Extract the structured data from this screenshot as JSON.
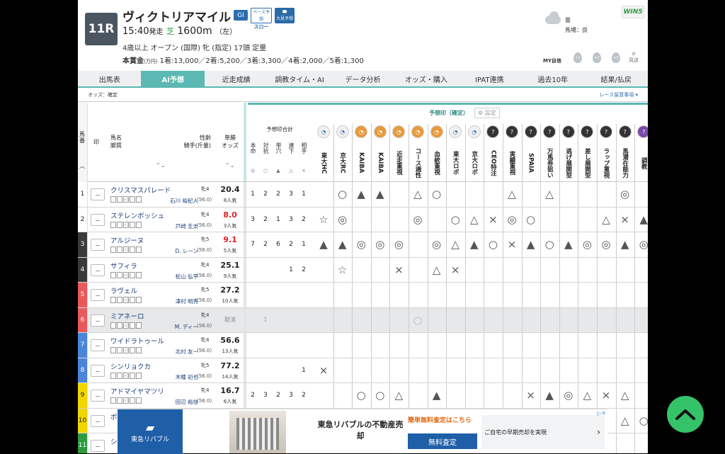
{
  "race": {
    "number": "11R",
    "name": "ヴィクトリアマイル",
    "grade": "GⅠ",
    "pace_badge_top": "ペース予想",
    "pace_badge_bottom": "スロー",
    "tenkai_badge": "大見予想",
    "time": "15:40",
    "start_suffix": "発走",
    "surface": "芝",
    "distance": "1600m",
    "direction": "（左）",
    "conditions": "4歳以上 オープン (国際) 牝 (指定) 17頭 定量",
    "prize_label": "本賞金",
    "prize_unit": "(万円)",
    "prizes": "1着:13,000／2着:5,200／3着:3,300／4着:2,000／5着:1,300",
    "weather": "曇",
    "track": "馬場：良",
    "win5": "WIN5",
    "my_jishin": "MY自信",
    "my_levels": [
      "+1",
      "+2",
      "+3"
    ],
    "miokuri": "見送"
  },
  "tabs": [
    {
      "label": "出馬表",
      "active": false
    },
    {
      "label": "AI予想",
      "active": true
    },
    {
      "label": "近走成績",
      "active": false
    },
    {
      "label": "調教タイム・AI",
      "active": false
    },
    {
      "label": "データ分析",
      "active": false
    },
    {
      "label": "オッズ・購入",
      "active": false
    },
    {
      "label": "IPAT連携",
      "active": false
    },
    {
      "label": "過去10年",
      "active": false
    },
    {
      "label": "結果/払戻",
      "active": false
    }
  ],
  "subbar": {
    "odds_status": "オッズ：確定",
    "caution": "レース留意事項"
  },
  "table_header": {
    "umaban": "馬番",
    "shirushi": "印",
    "horse": "馬名",
    "legs": "脚質",
    "sex_age": "性齢",
    "jockey_weight": "騎手(斤量)",
    "odds": "単勝",
    "odds2": "オッズ",
    "yoso_total": "予想印合計",
    "yoso_confirmed": "予想印（確定）",
    "settings": "設定",
    "count_cols": [
      {
        "label": "本命",
        "glyph": "◎"
      },
      {
        "label": "対抗",
        "glyph": "○"
      },
      {
        "label": "単穴",
        "glyph": "▲"
      },
      {
        "label": "連下",
        "glyph": "△"
      },
      {
        "label": "相手",
        "glyph": "×"
      }
    ],
    "predictors": [
      {
        "name": "東大HC",
        "color": "#f0f0f0"
      },
      {
        "name": "京大RC",
        "color": "#f0f0f0"
      },
      {
        "name": "KAIBA",
        "color": "#e89a3c"
      },
      {
        "name": "KAIBA",
        "color": "#e89a3c"
      },
      {
        "name": "近走重視",
        "color": "#e89a3c"
      },
      {
        "name": "コース適性",
        "color": "#e89a3c"
      },
      {
        "name": "血統重視",
        "color": "#e89a3c"
      },
      {
        "name": "東大ロボ",
        "color": "#f0f0f0"
      },
      {
        "name": "京大ロボ",
        "color": "#f0f0f0"
      },
      {
        "name": "CEO特注",
        "color": "#333333"
      },
      {
        "name": "実績重視",
        "color": "#333333"
      },
      {
        "name": "SPAIA",
        "color": "#333333"
      },
      {
        "name": "万馬券狙い",
        "color": "#333333"
      },
      {
        "name": "逃げ展開型",
        "color": "#333333"
      },
      {
        "name": "差し展開型",
        "color": "#333333"
      },
      {
        "name": "ラップ重視",
        "color": "#333333"
      },
      {
        "name": "馬潜在能力",
        "color": "#333333"
      },
      {
        "name": "調教",
        "color": "#7a4aa8"
      }
    ]
  },
  "horses": [
    {
      "num": "1",
      "color": "#ffffff",
      "tcolor": "#222",
      "name": "クリスマスパレード",
      "sex_age": "牝4",
      "jockey": "石川 裕紀人",
      "weight": "(56.0)",
      "odds": "20.4",
      "red": false,
      "pop": "8人気",
      "counts": [
        "1",
        "2",
        "2",
        "3",
        "1"
      ],
      "marks": [
        "",
        "○",
        "▲",
        "▲",
        "",
        "△",
        "○",
        "",
        "",
        "",
        "△",
        "",
        "△",
        "",
        "",
        "",
        "◎",
        ""
      ]
    },
    {
      "num": "2",
      "color": "#ffffff",
      "tcolor": "#222",
      "name": "ステレンボッシュ",
      "sex_age": "牝4",
      "jockey": "戸崎 圭太",
      "weight": "(56.0)",
      "odds": "8.0",
      "red": true,
      "pop": "3人気",
      "counts": [
        "3",
        "2",
        "1",
        "3",
        "2"
      ],
      "marks": [
        "☆",
        "◎",
        "",
        "",
        "",
        "◎",
        "",
        "○",
        "△",
        "×",
        "◎",
        "○",
        "",
        "",
        "",
        "△",
        "×",
        "▲"
      ]
    },
    {
      "num": "3",
      "color": "#3a3a3a",
      "tcolor": "#fff",
      "name": "アルジーヌ",
      "sex_age": "牝5",
      "jockey": "D. レーン",
      "weight": "(56.0)",
      "odds": "9.1",
      "red": true,
      "pop": "5人気",
      "counts": [
        "7",
        "2",
        "6",
        "2",
        "1"
      ],
      "marks": [
        "▲",
        "▲",
        "◎",
        "◎",
        "◎",
        "",
        "◎",
        "△",
        "▲",
        "○",
        "×",
        "▲",
        "○",
        "▲",
        "◎",
        "◎",
        "▲",
        "◎"
      ]
    },
    {
      "num": "4",
      "color": "#3a3a3a",
      "tcolor": "#fff",
      "name": "サフィラ",
      "sex_age": "牝4",
      "jockey": "松山 弘平",
      "weight": "(56.0)",
      "odds": "25.1",
      "red": false,
      "pop": "9人気",
      "counts": [
        "",
        "",
        "",
        "1",
        "2"
      ],
      "marks": [
        "",
        "☆",
        "",
        "",
        "×",
        "",
        "△",
        "×",
        "",
        "",
        "",
        "",
        "",
        "",
        "",
        "",
        "",
        ""
      ]
    },
    {
      "num": "5",
      "color": "#e85a5a",
      "tcolor": "#fff",
      "name": "ラヴェル",
      "sex_age": "牝5",
      "jockey": "津村 明秀",
      "weight": "(56.0)",
      "odds": "27.2",
      "red": false,
      "pop": "10人気",
      "counts": [
        "",
        "",
        "",
        "",
        ""
      ],
      "marks": [
        "",
        "",
        "",
        "",
        "",
        "",
        "",
        "",
        "",
        "",
        "",
        "",
        "",
        "",
        "",
        "",
        "",
        ""
      ]
    },
    {
      "num": "6",
      "color": "#e85a5a",
      "tcolor": "#fff",
      "name": "ミアネーロ",
      "sex_age": "牝4",
      "jockey": "M. ディー",
      "weight": "(56.0)",
      "odds": "取消",
      "red": false,
      "pop": "",
      "scratch": true,
      "counts": [
        "",
        "1",
        "",
        "",
        ""
      ],
      "marks": [
        "",
        "",
        "",
        "",
        "",
        "○",
        "",
        "",
        "",
        "",
        "",
        "",
        "",
        "",
        "",
        "",
        "",
        ""
      ]
    },
    {
      "num": "7",
      "color": "#4a86d8",
      "tcolor": "#fff",
      "name": "ワイドラトゥール",
      "sex_age": "牝4",
      "jockey": "北村 友一",
      "weight": "(56.0)",
      "odds": "56.6",
      "red": false,
      "pop": "13人気",
      "counts": [
        "",
        "",
        "",
        "",
        ""
      ],
      "marks": [
        "",
        "",
        "",
        "",
        "",
        "",
        "",
        "",
        "",
        "",
        "",
        "",
        "",
        "",
        "",
        "",
        "",
        ""
      ]
    },
    {
      "num": "8",
      "color": "#4a86d8",
      "tcolor": "#fff",
      "name": "シンリョクカ",
      "sex_age": "牝5",
      "jockey": "木幡 初也",
      "weight": "(56.0)",
      "odds": "77.2",
      "red": false,
      "pop": "14人気",
      "counts": [
        "",
        "",
        "",
        "",
        "1"
      ],
      "marks": [
        "×",
        "",
        "",
        "",
        "",
        "",
        "",
        "",
        "",
        "",
        "",
        "",
        "",
        "",
        "",
        "",
        "",
        ""
      ]
    },
    {
      "num": "9",
      "color": "#f2d600",
      "tcolor": "#222",
      "name": "アドマイヤマツリ",
      "sex_age": "牝4",
      "jockey": "田辺 裕信",
      "weight": "(56.0)",
      "odds": "16.7",
      "red": false,
      "pop": "6人気",
      "counts": [
        "2",
        "3",
        "2",
        "3",
        "2"
      ],
      "marks": [
        "",
        "",
        "○",
        "○",
        "△",
        "",
        "▲",
        "",
        "",
        "",
        "",
        "×",
        "▲",
        "◎",
        "△",
        "×",
        "△",
        ""
      ]
    },
    {
      "num": "10",
      "color": "#f2d600",
      "tcolor": "#222",
      "name": "ボ",
      "sex_age": "",
      "jockey": "",
      "weight": "",
      "odds": "",
      "red": false,
      "pop": "",
      "counts": [
        "",
        "",
        "",
        "",
        ""
      ],
      "marks": [
        "",
        "",
        "",
        "",
        "",
        "",
        "",
        "",
        "",
        "",
        "",
        "",
        "",
        "",
        "",
        "",
        "△",
        "○"
      ]
    },
    {
      "num": "11",
      "color": "#2e9a3e",
      "tcolor": "#fff",
      "name": "シ",
      "sex_age": "",
      "jockey": "",
      "weight": "",
      "odds": "",
      "red": false,
      "pop": "",
      "counts": [
        "",
        "",
        "",
        "",
        ""
      ],
      "marks": [
        "",
        "",
        "",
        "",
        "",
        "",
        "",
        "",
        "",
        "",
        "",
        "",
        "",
        "",
        "",
        "",
        "",
        ""
      ]
    }
  ],
  "ad": {
    "brand": "東急リバブル",
    "title": "東急リバブルの不動産売却",
    "cta_top": "簡単無料査定はこちら",
    "cta_button": "無料査定",
    "right_text": "ご自宅の早期売却を実現"
  },
  "accent": "#5cb8b2"
}
